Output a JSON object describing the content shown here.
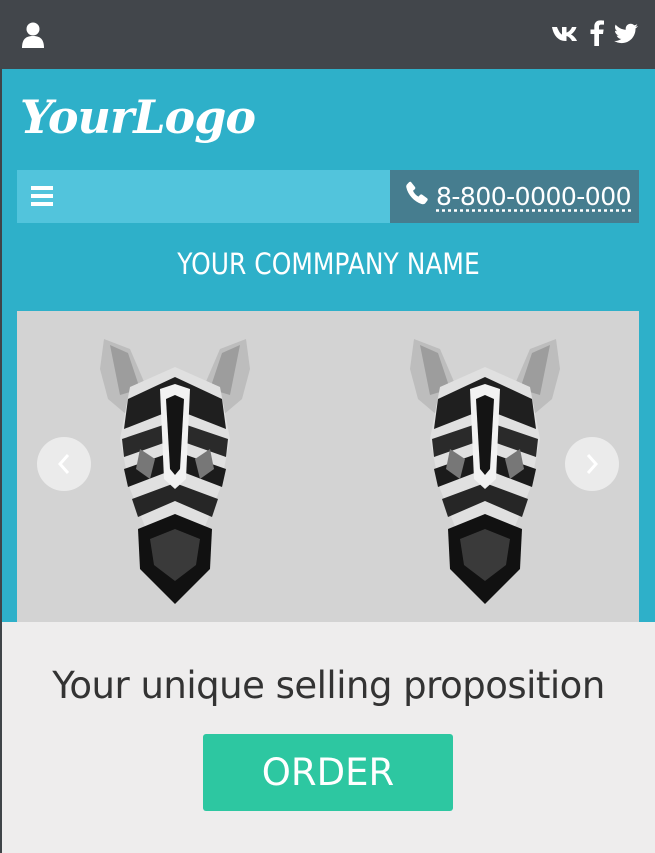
{
  "topbar": {
    "user_icon": "user-icon",
    "social": [
      "vk-icon",
      "facebook-icon",
      "twitter-icon"
    ]
  },
  "header": {
    "logo": "YourLogo",
    "menu_icon": "hamburger-menu-icon",
    "phone_icon": "phone-icon",
    "phone": "8-800-0000-000",
    "company_name": "YOUR COMMPANY NAME"
  },
  "slider": {
    "images": [
      "zebra-head",
      "zebra-head"
    ],
    "prev_icon": "chevron-left-icon",
    "next_icon": "chevron-right-icon"
  },
  "content": {
    "usp": "Your unique selling proposition",
    "order_label": "ORDER"
  },
  "colors": {
    "topbar": "#42464b",
    "header": "#2eb0c9",
    "navbar": "#52c4dc",
    "phone_bg": "#467d8f",
    "content_bg": "#eeeded",
    "order_button": "#2dc7a1"
  }
}
